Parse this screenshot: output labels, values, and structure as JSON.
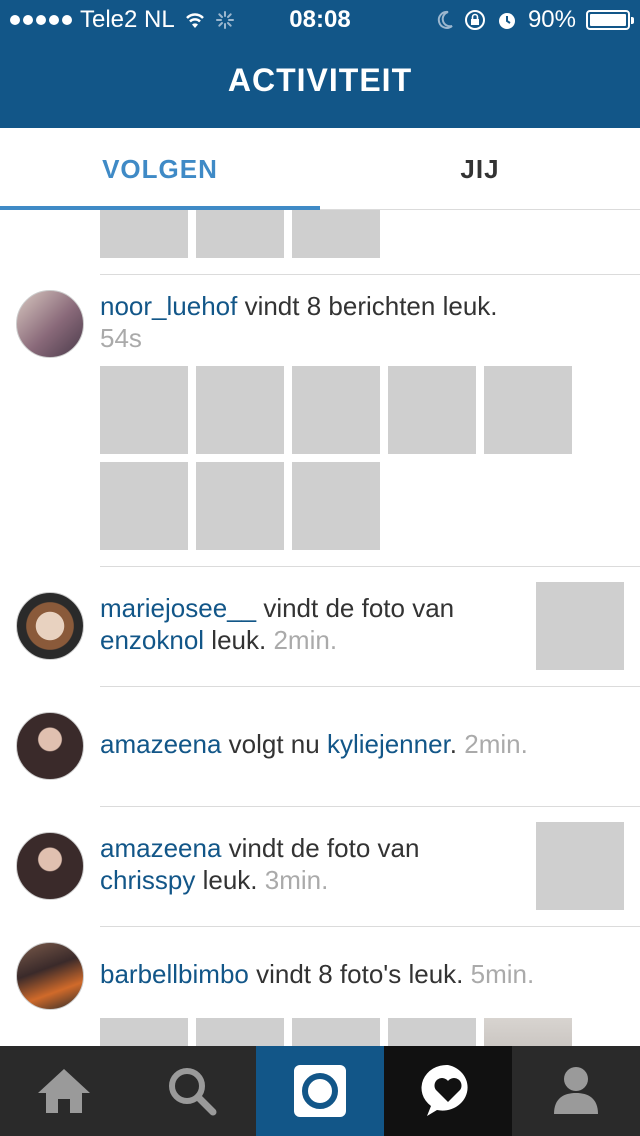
{
  "status_bar": {
    "carrier": "Tele2 NL",
    "time": "08:08",
    "battery": "90%",
    "battery_level": 0.9
  },
  "header": {
    "title": "ACTIVITEIT"
  },
  "tabs": [
    {
      "label": "VOLGEN",
      "active": true
    },
    {
      "label": "JIJ",
      "active": false
    }
  ],
  "feed": [
    {
      "user": "noor_luehof",
      "text": " vindt 8 berichten leuk.",
      "time": "54s",
      "thumbnails": 8
    },
    {
      "user": "mariejosee__",
      "text1": " vindt de foto van",
      "user2": "enzoknol",
      "text2": " leuk.",
      "time": "2min."
    },
    {
      "user": "amazeena",
      "text1": " volgt nu ",
      "user2": "kyliejenner",
      "text2": ".",
      "time": "2min."
    },
    {
      "user": "amazeena",
      "text1": " vindt de foto van",
      "user2": "chrisspy",
      "text2": " leuk.",
      "time": "3min."
    },
    {
      "user": "barbellbimbo",
      "text": " vindt 8 foto's leuk.",
      "time": "5min."
    }
  ],
  "icons": {
    "home": "home-icon",
    "search": "search-icon",
    "camera": "camera-icon",
    "activity": "heart-bubble-icon",
    "profile": "profile-icon"
  },
  "colors": {
    "brand": "#125688",
    "accent": "#3f8ac6",
    "link": "#125688",
    "muted": "#aaaaaa"
  }
}
